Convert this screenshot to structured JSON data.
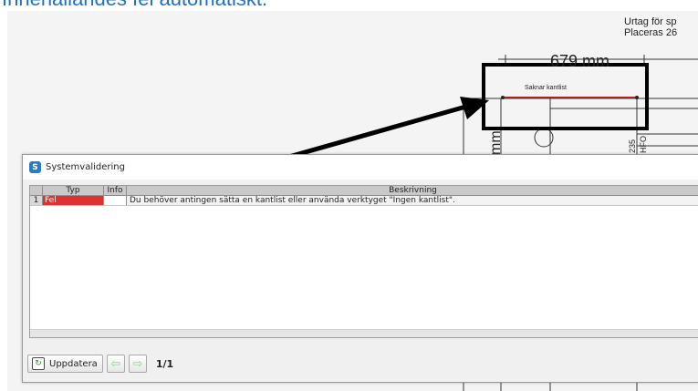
{
  "caption": "Innehallandes fel automatiskt.",
  "drawing": {
    "dimension": "679 mm",
    "note_line1": "Urtag för sp",
    "note_line2": "Placeras 26",
    "edge_label": "Saknar kantlist",
    "side_text_mm": "mm",
    "side_text_235": "235",
    "side_text_code": "HFO"
  },
  "dialog": {
    "title": "Systemvalidering",
    "columns": [
      "",
      "Typ",
      "Info",
      "Beskrivning"
    ],
    "rows": [
      {
        "num": "1",
        "type": "Fel",
        "info": "",
        "description": "Du behöver antingen sätta en kantlist eller använda verktyget \"Ingen kantlist\"."
      }
    ],
    "update_label": "Uppdatera",
    "pager": "1/1"
  },
  "colors": {
    "error": "#e03030",
    "annotation": "#000000",
    "caption": "#1d6fc4"
  }
}
